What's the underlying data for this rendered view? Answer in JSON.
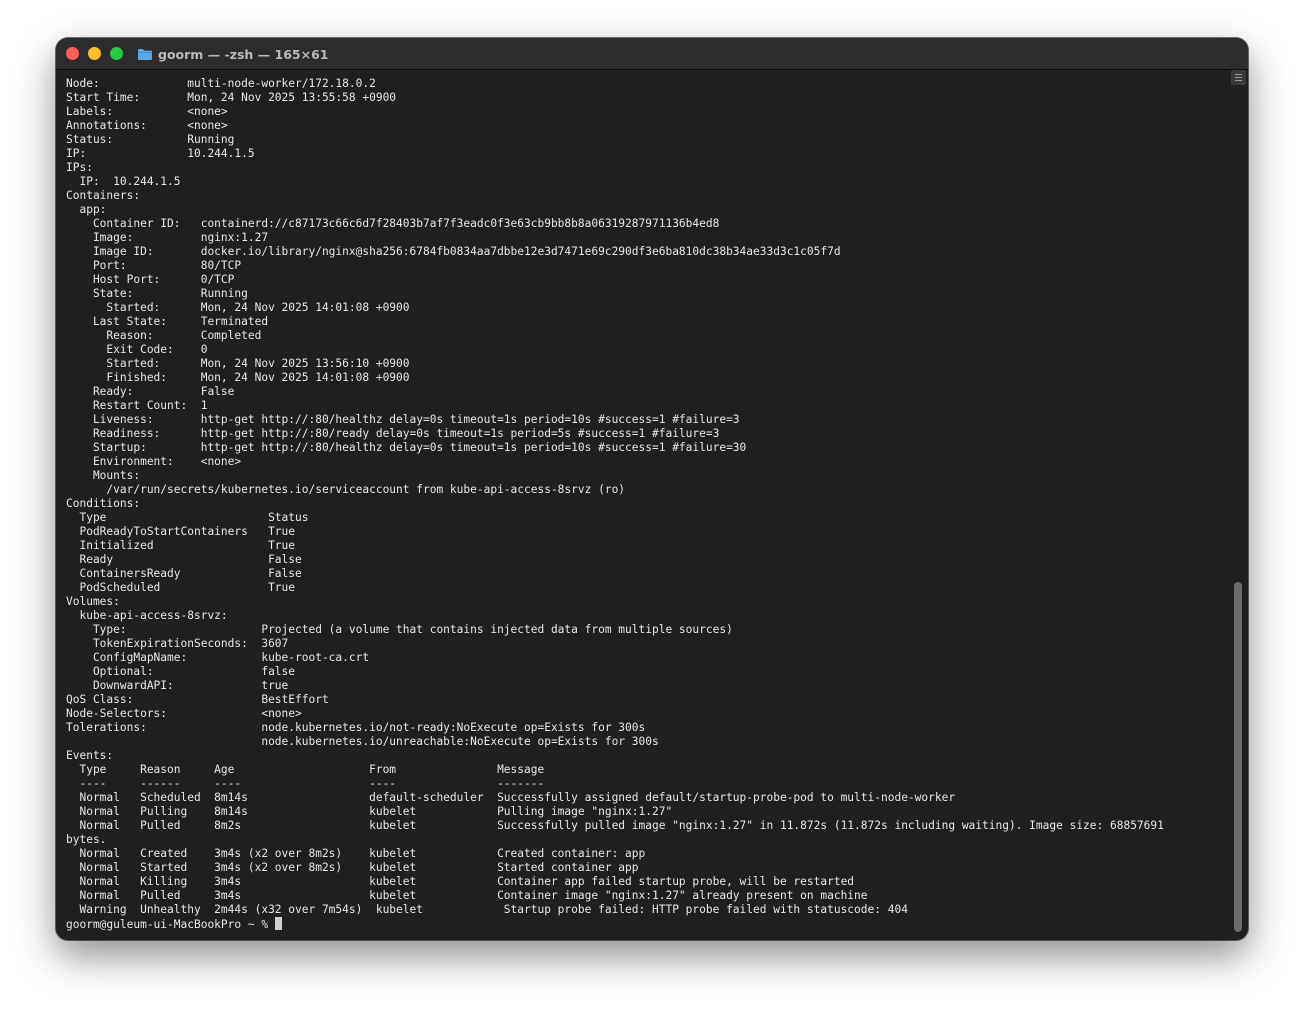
{
  "window": {
    "title": "goorm — -zsh — 165×61",
    "colors": {
      "close": "#ff5f57",
      "minimize": "#febc2e",
      "zoom": "#28c840",
      "background": "#1f1f1f",
      "text": "#e8e8e8"
    }
  },
  "terminal": {
    "lines": [
      "Node:             multi-node-worker/172.18.0.2",
      "Start Time:       Mon, 24 Nov 2025 13:55:58 +0900",
      "Labels:           <none>",
      "Annotations:      <none>",
      "Status:           Running",
      "IP:               10.244.1.5",
      "IPs:",
      "  IP:  10.244.1.5",
      "Containers:",
      "  app:",
      "    Container ID:   containerd://c87173c66c6d7f28403b7af7f3eadc0f3e63cb9bb8b8a06319287971136b4ed8",
      "    Image:          nginx:1.27",
      "    Image ID:       docker.io/library/nginx@sha256:6784fb0834aa7dbbe12e3d7471e69c290df3e6ba810dc38b34ae33d3c1c05f7d",
      "    Port:           80/TCP",
      "    Host Port:      0/TCP",
      "    State:          Running",
      "      Started:      Mon, 24 Nov 2025 14:01:08 +0900",
      "    Last State:     Terminated",
      "      Reason:       Completed",
      "      Exit Code:    0",
      "      Started:      Mon, 24 Nov 2025 13:56:10 +0900",
      "      Finished:     Mon, 24 Nov 2025 14:01:08 +0900",
      "    Ready:          False",
      "    Restart Count:  1",
      "    Liveness:       http-get http://:80/healthz delay=0s timeout=1s period=10s #success=1 #failure=3",
      "    Readiness:      http-get http://:80/ready delay=0s timeout=1s period=5s #success=1 #failure=3",
      "    Startup:        http-get http://:80/healthz delay=0s timeout=1s period=10s #success=1 #failure=30",
      "    Environment:    <none>",
      "    Mounts:",
      "      /var/run/secrets/kubernetes.io/serviceaccount from kube-api-access-8srvz (ro)",
      "Conditions:",
      "  Type                        Status",
      "  PodReadyToStartContainers   True",
      "  Initialized                 True",
      "  Ready                       False",
      "  ContainersReady             False",
      "  PodScheduled                True",
      "Volumes:",
      "  kube-api-access-8srvz:",
      "    Type:                    Projected (a volume that contains injected data from multiple sources)",
      "    TokenExpirationSeconds:  3607",
      "    ConfigMapName:           kube-root-ca.crt",
      "    Optional:                false",
      "    DownwardAPI:             true",
      "QoS Class:                   BestEffort",
      "Node-Selectors:              <none>",
      "Tolerations:                 node.kubernetes.io/not-ready:NoExecute op=Exists for 300s",
      "                             node.kubernetes.io/unreachable:NoExecute op=Exists for 300s",
      "Events:",
      "  Type     Reason     Age                    From               Message",
      "  ----     ------     ----                   ----               -------",
      "  Normal   Scheduled  8m14s                  default-scheduler  Successfully assigned default/startup-probe-pod to multi-node-worker",
      "  Normal   Pulling    8m14s                  kubelet            Pulling image \"nginx:1.27\"",
      "  Normal   Pulled     8m2s                   kubelet            Successfully pulled image \"nginx:1.27\" in 11.872s (11.872s including waiting). Image size: 68857691",
      "bytes.",
      "  Normal   Created    3m4s (x2 over 8m2s)    kubelet            Created container: app",
      "  Normal   Started    3m4s (x2 over 8m2s)    kubelet            Started container app",
      "  Normal   Killing    3m4s                   kubelet            Container app failed startup probe, will be restarted",
      "  Normal   Pulled     3m4s                   kubelet            Container image \"nginx:1.27\" already present on machine",
      "  Warning  Unhealthy  2m44s (x32 over 7m54s)  kubelet            Startup probe failed: HTTP probe failed with statuscode: 404"
    ],
    "prompt": "goorm@guleum-ui-MacBookPro ~ % "
  }
}
